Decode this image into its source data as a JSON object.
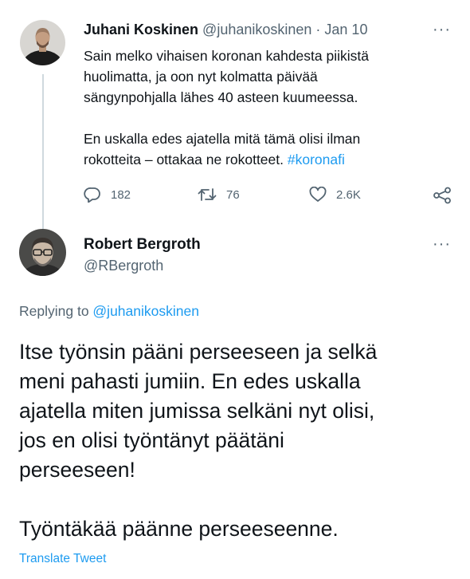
{
  "tweet1": {
    "name": "Juhani Koskinen",
    "handle": "@juhanikoskinen",
    "separator": " · ",
    "date": "Jan 10",
    "more_label": "···",
    "paragraph1_lines": [
      "Sain melko vihaisen koronan kahdesta piikistä",
      "huolimatta, ja oon nyt kolmatta päivää",
      "sängynpohjalla lähes 40 asteen kuumeessa."
    ],
    "paragraph2_line1": "En uskalla edes ajatella mitä tämä olisi ilman",
    "paragraph2_line2_text": "rokotteita – ottakaa ne rokotteet. ",
    "hashtag": "#koronafi",
    "replies": "182",
    "retweets": "76",
    "likes": "2.6K"
  },
  "tweet2": {
    "name": "Robert Bergroth",
    "handle": "@RBergroth",
    "more_label": "···",
    "replying_prefix": "Replying to ",
    "replying_to": "@juhanikoskinen",
    "paragraph1_lines": [
      "Itse työnsin pääni perseeseen ja selkä",
      "meni pahasti jumiin. En edes uskalla",
      "ajatella miten jumissa selkäni nyt olisi,",
      "jos en olisi työntänyt päätäni",
      "perseeseen!"
    ],
    "paragraph2": "Työntäkää päänne perseeseenne.",
    "translate_label": "Translate Tweet"
  },
  "icons": {
    "reply": "reply-icon",
    "retweet": "retweet-icon",
    "like": "heart-icon",
    "share": "share-icon",
    "more": "more-icon"
  },
  "colors": {
    "link": "#1d9bf0",
    "secondary_text": "#536471",
    "primary_text": "#0f1419",
    "thread_line": "#cfd9de"
  }
}
